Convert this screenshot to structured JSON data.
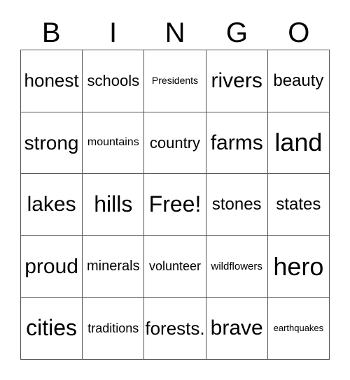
{
  "card": {
    "title_letters": [
      "B",
      "I",
      "N",
      "G",
      "O"
    ],
    "free_space_label": "Free!",
    "colors": {
      "background": "#ffffff",
      "cell_background": "#ffffff",
      "grid_line": "#555555",
      "text": "#000000"
    },
    "columns": 5,
    "rows": 5,
    "cells": [
      [
        {
          "text": "honest",
          "size": "sz-26"
        },
        {
          "text": "schools",
          "size": "sz-22"
        },
        {
          "text": "Presidents",
          "size": "sz-14"
        },
        {
          "text": "rivers",
          "size": "sz-30"
        },
        {
          "text": "beauty",
          "size": "sz-24"
        }
      ],
      [
        {
          "text": "strong",
          "size": "sz-28"
        },
        {
          "text": "mountains",
          "size": "sz-16"
        },
        {
          "text": "country",
          "size": "sz-22"
        },
        {
          "text": "farms",
          "size": "sz-30"
        },
        {
          "text": "land",
          "size": "sz-36"
        }
      ],
      [
        {
          "text": "lakes",
          "size": "sz-30"
        },
        {
          "text": "hills",
          "size": "sz-32"
        },
        {
          "text": "Free!",
          "size": "sz-32"
        },
        {
          "text": "stones",
          "size": "sz-24"
        },
        {
          "text": "states",
          "size": "sz-24"
        }
      ],
      [
        {
          "text": "proud",
          "size": "sz-30"
        },
        {
          "text": "minerals",
          "size": "sz-20"
        },
        {
          "text": "volunteer",
          "size": "sz-18"
        },
        {
          "text": "wildflowers",
          "size": "sz-15"
        },
        {
          "text": "hero",
          "size": "sz-36"
        }
      ],
      [
        {
          "text": "cities",
          "size": "sz-32"
        },
        {
          "text": "traditions",
          "size": "sz-18"
        },
        {
          "text": "forests.",
          "size": "sz-26"
        },
        {
          "text": "brave",
          "size": "sz-30"
        },
        {
          "text": "earthquakes",
          "size": "sz-13"
        }
      ]
    ]
  }
}
